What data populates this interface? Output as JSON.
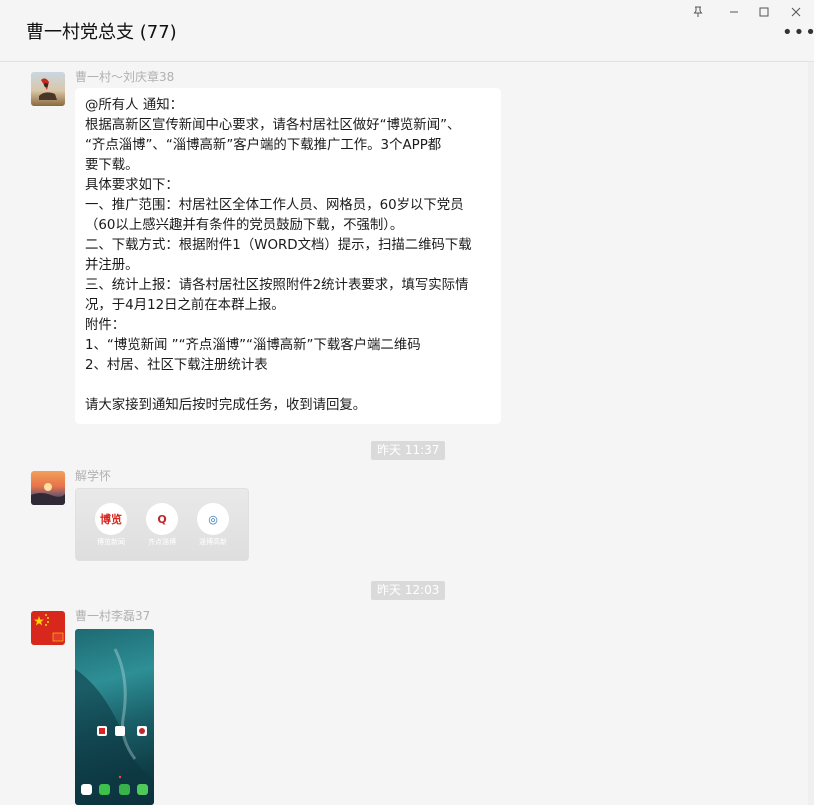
{
  "window": {
    "title": "曹一村党总支 (77)",
    "pin_glyph": "⚲",
    "minimize_glyph": "—",
    "maximize_glyph": "☐",
    "close_glyph": "✕",
    "more_glyph": "•••"
  },
  "messages": [
    {
      "sender": "曹一村～刘庆章38",
      "avatar_icon": "person-on-horse-avatar",
      "text_lines": [
        "@所有人 通知：",
        "根据高新区宣传新闻中心要求，请各村居社区做好“博览新闻”、",
        "“齐点淄博”、“淄博高新”客户端的下载推广工作。3个APP都",
        "要下载。",
        "具体要求如下：",
        "一、推广范围：村居社区全体工作人员、网格员，60岁以下党员",
        "（60以上感兴趣并有条件的党员鼓励下载，不强制）。",
        "二、下载方式：根据附件1（WORD文档）提示，扫描二维码下载",
        "并注册。",
        "三、统计上报：请各村居社区按照附件2统计表要求，填写实际情",
        "况，于4月12日之前在本群上报。",
        "附件：",
        "1、“博览新闻 ”“齐点淄博”“淄博高新”下载客户端二维码",
        "2、村居、社区下载注册统计表",
        "",
        "请大家接到通知后按时完成任务，收到请回复。"
      ]
    },
    {
      "timestamp": "昨天 11:37"
    },
    {
      "sender": "解学怀",
      "avatar_icon": "sunset-avatar",
      "image": {
        "apps": [
          {
            "icon_text": "博览",
            "label": "博览新闻",
            "color": "#d8261f"
          },
          {
            "icon_text": "Q",
            "label": "齐点淄博",
            "color": "#c0262a"
          },
          {
            "icon_text": "◎",
            "label": "淄博高新",
            "color": "#2a6fb8"
          }
        ]
      }
    },
    {
      "timestamp": "昨天 12:03"
    },
    {
      "sender": "曹一村李磊37",
      "avatar_icon": "china-flag-avatar",
      "image": {
        "type": "phone-homescreen-screenshot"
      }
    }
  ]
}
